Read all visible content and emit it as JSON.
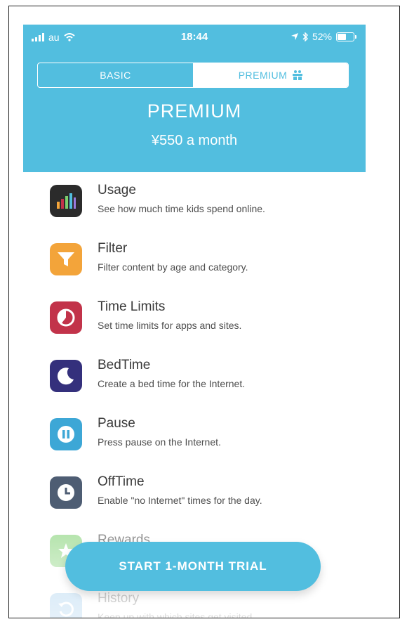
{
  "status_bar": {
    "carrier": "au",
    "time": "18:44",
    "battery": "52%"
  },
  "tabs": [
    {
      "label": "BASIC",
      "selected": false
    },
    {
      "label": "PREMIUM",
      "selected": true
    }
  ],
  "plan": {
    "title": "PREMIUM",
    "price": "¥550 a month"
  },
  "features": [
    {
      "title": "Usage",
      "description": "See how much time kids spend online.",
      "icon": "bar-chart-icon",
      "color": "#2b2b2b"
    },
    {
      "title": "Filter",
      "description": "Filter content by age and category.",
      "icon": "funnel-icon",
      "color": "#f3a43a"
    },
    {
      "title": "Time Limits",
      "description": "Set time limits for apps and sites.",
      "icon": "pie-timer-icon",
      "color": "#c2334a"
    },
    {
      "title": "BedTime",
      "description": "Create a bed time for the Internet.",
      "icon": "moon-icon",
      "color": "#34307c"
    },
    {
      "title": "Pause",
      "description": "Press pause on the Internet.",
      "icon": "pause-icon",
      "color": "#3da7d6"
    },
    {
      "title": "OffTime",
      "description": "Enable \"no Internet\" times for the day.",
      "icon": "clock-icon",
      "color": "#4e5d73"
    },
    {
      "title": "Rewards",
      "description": "",
      "icon": "star-icon",
      "color": "#7ccf6e"
    },
    {
      "title": "History",
      "description": "Keep up with which sites get visited.",
      "icon": "history-icon",
      "color": "#7ab7e6"
    }
  ],
  "cta": {
    "label": "START 1-MONTH TRIAL"
  },
  "colors": {
    "accent": "#52bedf"
  }
}
